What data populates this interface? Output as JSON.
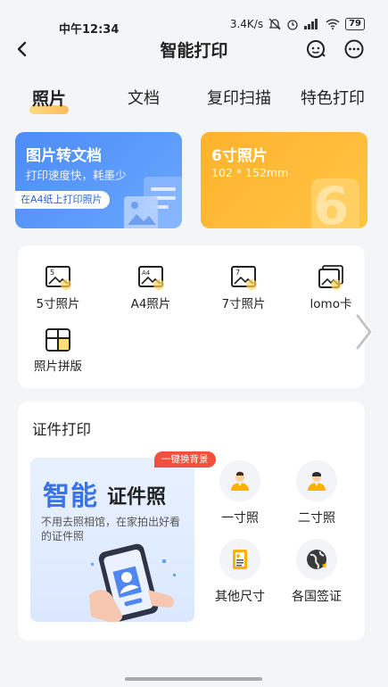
{
  "status": {
    "time": "中午12:34",
    "speed": "3.4K/s",
    "battery": "79"
  },
  "nav": {
    "title": "智能打印",
    "back_icon": "chevron-left-icon",
    "assistant_icon": "chat-bot-icon",
    "more_icon": "more-horizontal-icon"
  },
  "tabs": [
    {
      "label": "照片",
      "active": true
    },
    {
      "label": "文档",
      "active": false
    },
    {
      "label": "复印扫描",
      "active": false
    },
    {
      "label": "特色打印",
      "active": false
    }
  ],
  "promo_left": {
    "title": "图片转文档",
    "subtitle": "打印速度快，耗墨少",
    "pill": "在A4纸上打印照片",
    "color": "#4c8cf7"
  },
  "promo_right": {
    "title": "6寸照片",
    "subtitle": "102 * 152mm",
    "big_digit": "6",
    "color": "#ffb22e"
  },
  "photo_items": [
    {
      "label": "5寸照片",
      "icon_text": "5",
      "icon": "photo-5inch-icon"
    },
    {
      "label": "A4照片",
      "icon_text": "A4",
      "icon": "photo-a4-icon"
    },
    {
      "label": "7寸照片",
      "icon_text": "7",
      "icon": "photo-7inch-icon"
    },
    {
      "label": "lomo卡",
      "icon_text": "",
      "icon": "lomo-card-icon"
    },
    {
      "label": "照片拼版",
      "icon_text": "",
      "icon": "photo-collage-icon"
    }
  ],
  "id_section": {
    "title": "证件打印",
    "badge": "一键换背景",
    "banner_title_a": "智能",
    "banner_title_b": "证件照",
    "banner_desc": "不用去照相馆，在家拍出好看的证件照",
    "items": [
      {
        "label": "一寸照",
        "icon": "id-photo-1inch-icon"
      },
      {
        "label": "二寸照",
        "icon": "id-photo-2inch-icon"
      },
      {
        "label": "其他尺寸",
        "icon": "id-other-size-icon"
      },
      {
        "label": "各国签证",
        "icon": "visa-globe-icon"
      }
    ]
  }
}
